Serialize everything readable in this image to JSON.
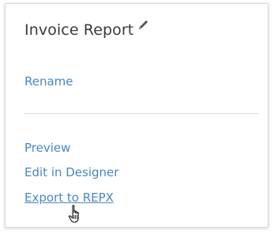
{
  "card": {
    "title": "Invoice Report",
    "edit_icon": "pencil-icon",
    "rename_label": "Rename",
    "actions": [
      {
        "label": "Preview"
      },
      {
        "label": "Edit in Designer"
      },
      {
        "label": "Export to REPX"
      }
    ]
  },
  "cursor_icon": "hand-pointer-icon",
  "colors": {
    "link": "#4a87c4",
    "title": "#3a3a3a",
    "divider": "#dcdcdc",
    "border": "#d9d9d9"
  }
}
